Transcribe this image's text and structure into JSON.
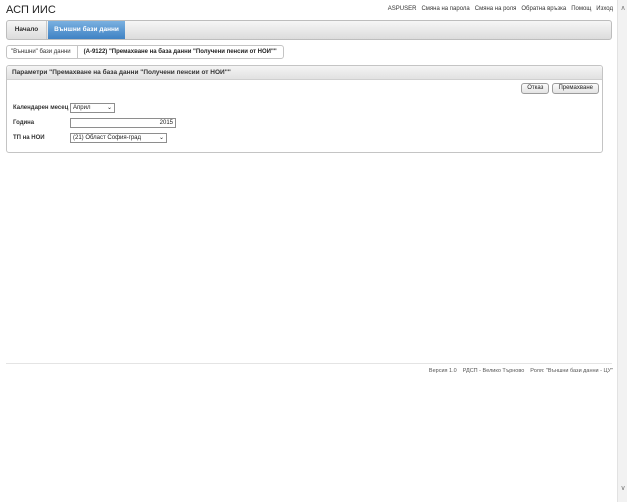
{
  "app": {
    "title": "АСП ИИС"
  },
  "top_links": [
    "ASPUSER",
    "Смяна на парола",
    "Смяна на роля",
    "Обратна връзка",
    "Помощ",
    "Изход"
  ],
  "nav": {
    "home": "Начало",
    "active": "Външни бази данни"
  },
  "breadcrumb": {
    "first": "\"Външни\" бази данни",
    "current": "(А-9122) \"Премахване на база данни \"Получени пенсии от НОИ\"\""
  },
  "panel": {
    "title": "Параметри \"Премахване на база данни \"Получени пенсии от НОИ\"\"",
    "cancel": "Отказ",
    "remove": "Премахване",
    "fields": {
      "month_label": "Календарен месец",
      "month_value": "Април",
      "year_label": "Година",
      "year_value": "2015",
      "tp_label": "ТП на НОИ",
      "tp_value": "(21) Област София-град"
    }
  },
  "footer": {
    "version": "Версия 1.0",
    "office": "РДСП - Велико Търново",
    "role": "Роля: \"Външни бази данни - ЦУ\""
  }
}
